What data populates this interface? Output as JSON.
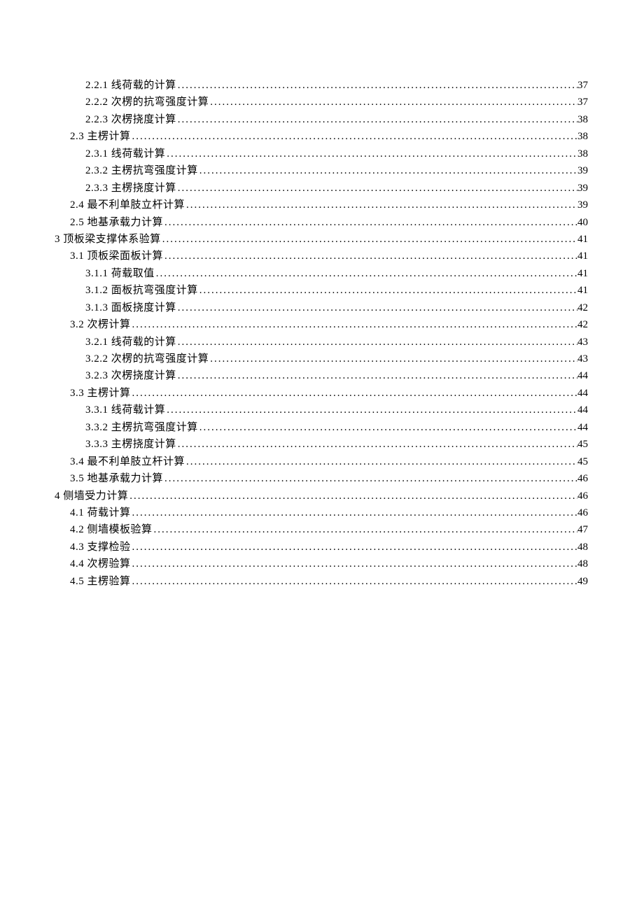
{
  "toc": [
    {
      "indent": 2,
      "label": "2.2.1 线荷载的计算",
      "page": "37"
    },
    {
      "indent": 2,
      "label": "2.2.2 次楞的抗弯强度计算",
      "page": "37"
    },
    {
      "indent": 2,
      "label": "2.2.3 次楞挠度计算",
      "page": "38"
    },
    {
      "indent": 1,
      "label": "2.3 主楞计算",
      "page": "38"
    },
    {
      "indent": 2,
      "label": "2.3.1 线荷载计算",
      "page": "38"
    },
    {
      "indent": 2,
      "label": "2.3.2 主楞抗弯强度计算",
      "page": "39"
    },
    {
      "indent": 2,
      "label": "2.3.3 主楞挠度计算",
      "page": "39"
    },
    {
      "indent": 1,
      "label": "2.4 最不利单肢立杆计算",
      "page": "39"
    },
    {
      "indent": 1,
      "label": "2.5 地基承载力计算",
      "page": "40"
    },
    {
      "indent": 0,
      "label": "3 顶板梁支撑体系验算",
      "page": "41"
    },
    {
      "indent": 1,
      "label": "3.1 顶板梁面板计算",
      "page": "41"
    },
    {
      "indent": 2,
      "label": "3.1.1 荷载取值",
      "page": "41"
    },
    {
      "indent": 2,
      "label": "3.1.2 面板抗弯强度计算",
      "page": "41"
    },
    {
      "indent": 2,
      "label": "3.1.3 面板挠度计算",
      "page": "42"
    },
    {
      "indent": 1,
      "label": "3.2 次楞计算",
      "page": "42"
    },
    {
      "indent": 2,
      "label": "3.2.1 线荷载的计算",
      "page": "43"
    },
    {
      "indent": 2,
      "label": "3.2.2 次楞的抗弯强度计算",
      "page": "43"
    },
    {
      "indent": 2,
      "label": "3.2.3 次楞挠度计算",
      "page": "44"
    },
    {
      "indent": 1,
      "label": "3.3 主楞计算",
      "page": "44"
    },
    {
      "indent": 2,
      "label": "3.3.1 线荷载计算",
      "page": "44"
    },
    {
      "indent": 2,
      "label": "3.3.2 主楞抗弯强度计算",
      "page": "44"
    },
    {
      "indent": 2,
      "label": "3.3.3 主楞挠度计算",
      "page": "45"
    },
    {
      "indent": 1,
      "label": "3.4 最不利单肢立杆计算",
      "page": "45"
    },
    {
      "indent": 1,
      "label": "3.5 地基承载力计算",
      "page": "46"
    },
    {
      "indent": 0,
      "label": "4 侧墙受力计算",
      "page": "46"
    },
    {
      "indent": 1,
      "label": "4.1 荷载计算",
      "page": "46"
    },
    {
      "indent": 1,
      "label": "4.2 侧墙模板验算",
      "page": "47"
    },
    {
      "indent": 1,
      "label": "4.3 支撑检验",
      "page": "48"
    },
    {
      "indent": 1,
      "label": "4.4 次楞验算",
      "page": "48"
    },
    {
      "indent": 1,
      "label": "4.5 主楞验算",
      "page": "49"
    }
  ]
}
